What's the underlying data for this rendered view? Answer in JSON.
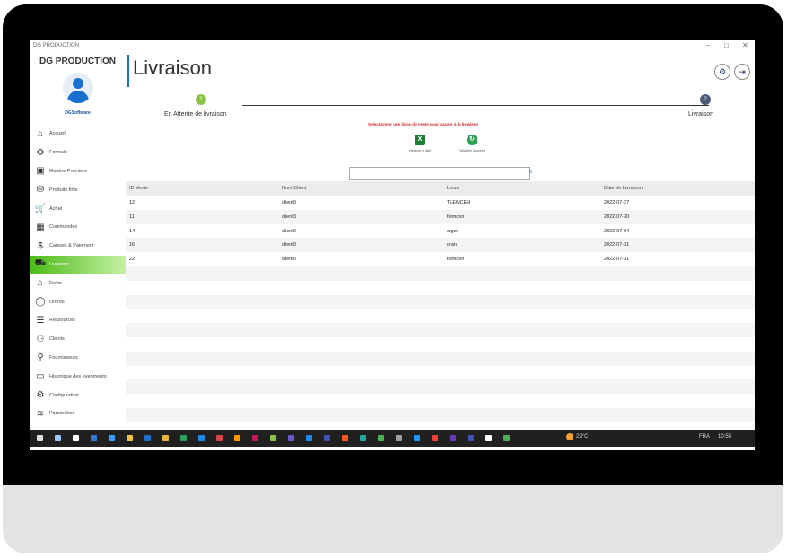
{
  "window": {
    "title": "DG PRODUCTION",
    "minimize": "–",
    "maximize": "□",
    "close": "✕"
  },
  "sidebar": {
    "brand": "DG PRODUCTION",
    "username": "DGSoftware",
    "items": [
      {
        "label": "Accueil",
        "icon": "home-icon",
        "glyph": "⌂"
      },
      {
        "label": "Formule",
        "icon": "gear-icon",
        "glyph": "⚙"
      },
      {
        "label": "Matière Premiere",
        "icon": "box-icon",
        "glyph": "▣"
      },
      {
        "label": "Produits finis",
        "icon": "product-icon",
        "glyph": "⛁"
      },
      {
        "label": "Achat",
        "icon": "cart-icon",
        "glyph": "🛒"
      },
      {
        "label": "Commandes",
        "icon": "orders-icon",
        "glyph": "▦"
      },
      {
        "label": "Caisses & Paiement",
        "icon": "cash-icon",
        "glyph": "$"
      },
      {
        "label": "Livraison",
        "icon": "truck-icon",
        "glyph": "⛟"
      },
      {
        "label": "Devis",
        "icon": "quote-icon",
        "glyph": "⌂"
      },
      {
        "label": "Ordres",
        "icon": "chat-icon",
        "glyph": "◯"
      },
      {
        "label": "Ressources",
        "icon": "list-icon",
        "glyph": "☰"
      },
      {
        "label": "Clients",
        "icon": "clients-icon",
        "glyph": "⚇"
      },
      {
        "label": "Fournisseurs",
        "icon": "user-icon",
        "glyph": "⚲"
      },
      {
        "label": "Historique des evenments",
        "icon": "calendar-icon",
        "glyph": "▭"
      },
      {
        "label": "Configuration",
        "icon": "settings-icon",
        "glyph": "⚙"
      },
      {
        "label": "Paramètres",
        "icon": "sliders-icon",
        "glyph": "≋"
      }
    ],
    "active_index": 7
  },
  "header": {
    "page_title": "Livraison",
    "settings_glyph": "⚙",
    "logout_glyph": "⇥"
  },
  "stepper": {
    "step1_number": "1",
    "step1_label": "En Attente de livraison",
    "step2_number": "2",
    "step2_label": "Livraison"
  },
  "instruction": "Selectionner une ligne du vente pour passer à la livraison",
  "tools": [
    {
      "label": "Imprimer la liste",
      "glyph": "X",
      "color": "#1e7e34"
    },
    {
      "label": "Rafraichir données",
      "glyph": "↻",
      "color": "#2e9e57"
    }
  ],
  "search": {
    "value": "",
    "icon_glyph": "⌕"
  },
  "table": {
    "headers": [
      "ID Vente",
      "Nom Client",
      "Lieux",
      "Date de Livraison"
    ],
    "rows": [
      [
        "12",
        "client0",
        "TLEMCEN",
        "2022-07-27"
      ],
      [
        "11",
        "client3",
        "tlemcen",
        "2022-07-30"
      ],
      [
        "14",
        "client0",
        "alger",
        "2022-07-04"
      ],
      [
        "16",
        "client0",
        "oran",
        "2022-07-31"
      ],
      [
        "22",
        "client0",
        "tlemcen",
        "2022-07-31"
      ]
    ]
  },
  "taskbar": {
    "weather": "22°C",
    "language": "FRA",
    "time": "10:55"
  }
}
